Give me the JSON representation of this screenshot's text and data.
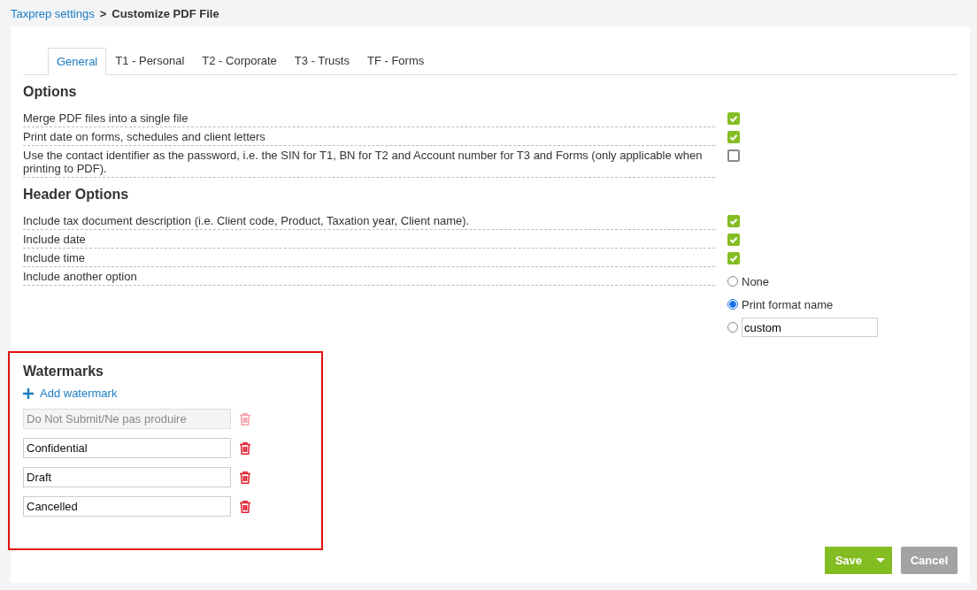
{
  "breadcrumb": {
    "parent": "Taxprep settings",
    "separator": ">",
    "current": "Customize PDF File"
  },
  "tabs": [
    {
      "label": "General",
      "selected": true
    },
    {
      "label": "T1 - Personal",
      "selected": false
    },
    {
      "label": "T2 - Corporate",
      "selected": false
    },
    {
      "label": "T3 - Trusts",
      "selected": false
    },
    {
      "label": "TF - Forms",
      "selected": false
    }
  ],
  "sections": [
    {
      "title": "Options",
      "items": [
        {
          "kind": "checkbox",
          "label": "Merge PDF files into a single file",
          "checked": true
        },
        {
          "kind": "checkbox",
          "label": "Print date on forms, schedules and client letters",
          "checked": true
        },
        {
          "kind": "checkbox",
          "label": "Use the contact identifier as the password, i.e. the SIN for T1, BN for T2 and Account number for T3 and Forms (only applicable when printing to PDF).",
          "checked": false
        }
      ]
    },
    {
      "title": "Header Options",
      "items": [
        {
          "kind": "checkbox",
          "label": "Include tax document description (i.e. Client code, Product, Taxation year, Client name).",
          "checked": true
        },
        {
          "kind": "checkbox",
          "label": "Include date",
          "checked": true
        },
        {
          "kind": "checkbox",
          "label": "Include time",
          "checked": true
        },
        {
          "kind": "radio",
          "label": "Include another option",
          "options": [
            {
              "kind": "label",
              "label": "None",
              "selected": false
            },
            {
              "kind": "label",
              "label": "Print format name",
              "selected": true
            },
            {
              "kind": "input",
              "value": "custom",
              "selected": false
            }
          ]
        }
      ]
    }
  ],
  "watermarks": {
    "title": "Watermarks",
    "highlighted": true,
    "add_label": "Add watermark",
    "items": [
      {
        "value": "Do Not Submit/Ne pas produire",
        "disabled": true
      },
      {
        "value": "Confidential",
        "disabled": false
      },
      {
        "value": "Draft",
        "disabled": false
      },
      {
        "value": "Cancelled",
        "disabled": false
      }
    ]
  },
  "buttons": {
    "save": "Save",
    "cancel": "Cancel"
  }
}
